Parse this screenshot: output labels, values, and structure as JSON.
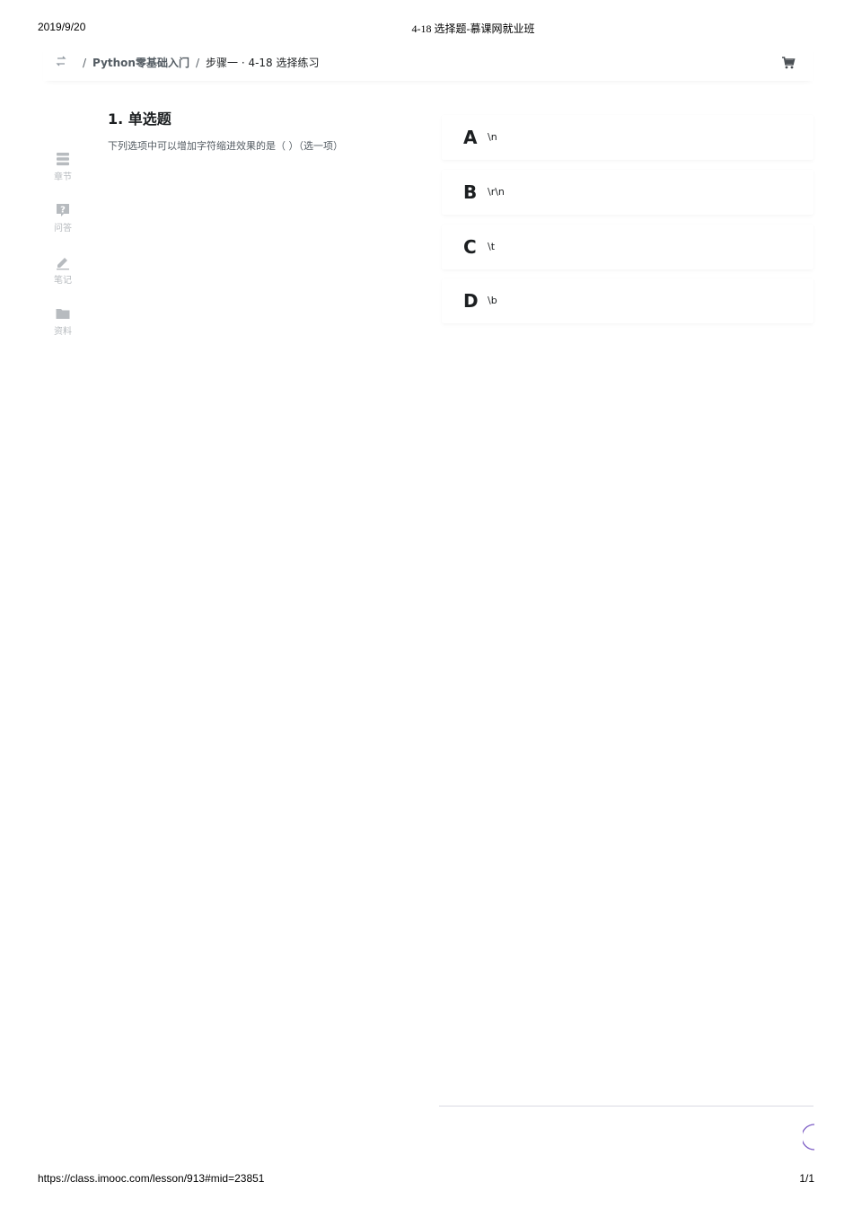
{
  "print_header": {
    "date": "2019/9/20",
    "title": "4-18 选择题-慕课网就业班"
  },
  "print_footer": {
    "url": "https://class.imooc.com/lesson/913#mid=23851",
    "page": "1/1"
  },
  "breadcrumb": {
    "separator": "/",
    "course": "Python零基础入门",
    "step": "步骤一 · 4-18 选择练习"
  },
  "sidebar": {
    "items": [
      {
        "label": "章节",
        "icon": "chapters-icon"
      },
      {
        "label": "问答",
        "icon": "question-icon"
      },
      {
        "label": "笔记",
        "icon": "pencil-icon"
      },
      {
        "label": "资料",
        "icon": "folder-icon"
      }
    ]
  },
  "question": {
    "title": "1. 单选题",
    "text": "下列选项中可以增加字符缩进效果的是（ ）（选一项）",
    "options": [
      {
        "letter": "A",
        "value": "\\n"
      },
      {
        "letter": "B",
        "value": "\\r\\n"
      },
      {
        "letter": "C",
        "value": "\\t"
      },
      {
        "letter": "D",
        "value": "\\b"
      }
    ]
  },
  "colors": {
    "text_primary": "#1c1f21",
    "text_secondary": "#545c63",
    "icon_muted": "#b7bbbf",
    "accent_purple": "#7b5bc4"
  }
}
